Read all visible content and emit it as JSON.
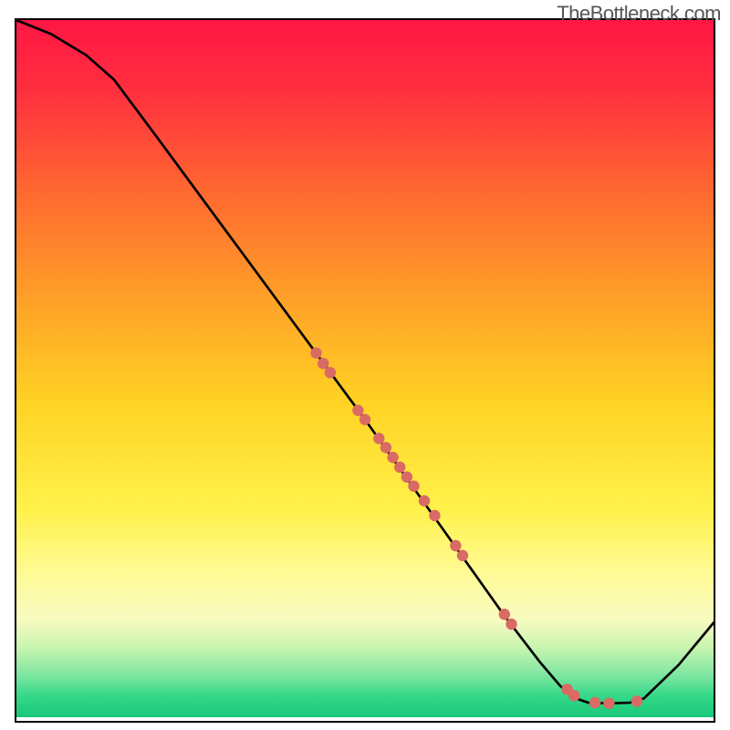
{
  "watermark": "TheBottleneck.com",
  "chart_data": {
    "type": "line",
    "title": "",
    "xlabel": "",
    "ylabel": "",
    "xlim": [
      0,
      100
    ],
    "ylim": [
      0,
      100
    ],
    "grid": false,
    "curve": [
      {
        "x": 0,
        "y": 100
      },
      {
        "x": 5,
        "y": 98
      },
      {
        "x": 10,
        "y": 95
      },
      {
        "x": 14,
        "y": 91.5
      },
      {
        "x": 20,
        "y": 83.5
      },
      {
        "x": 30,
        "y": 70
      },
      {
        "x": 40,
        "y": 56.5
      },
      {
        "x": 50,
        "y": 43
      },
      {
        "x": 55,
        "y": 36
      },
      {
        "x": 60,
        "y": 29
      },
      {
        "x": 65,
        "y": 22
      },
      {
        "x": 70,
        "y": 15
      },
      {
        "x": 75,
        "y": 8.5
      },
      {
        "x": 78,
        "y": 5
      },
      {
        "x": 80,
        "y": 3.3
      },
      {
        "x": 82,
        "y": 2.6
      },
      {
        "x": 85,
        "y": 2.5
      },
      {
        "x": 88,
        "y": 2.6
      },
      {
        "x": 90,
        "y": 3.2
      },
      {
        "x": 95,
        "y": 8
      },
      {
        "x": 100,
        "y": 14
      }
    ],
    "points": [
      {
        "x": 43,
        "y": 52.5
      },
      {
        "x": 44,
        "y": 51
      },
      {
        "x": 45,
        "y": 49.7
      },
      {
        "x": 49,
        "y": 44.3
      },
      {
        "x": 50,
        "y": 43
      },
      {
        "x": 52,
        "y": 40.3
      },
      {
        "x": 53,
        "y": 39
      },
      {
        "x": 54,
        "y": 37.6
      },
      {
        "x": 55,
        "y": 36.2
      },
      {
        "x": 56,
        "y": 34.8
      },
      {
        "x": 57,
        "y": 33.5
      },
      {
        "x": 58.5,
        "y": 31.4
      },
      {
        "x": 60,
        "y": 29.3
      },
      {
        "x": 63,
        "y": 25
      },
      {
        "x": 64,
        "y": 23.6
      },
      {
        "x": 70,
        "y": 15.2
      },
      {
        "x": 71,
        "y": 13.8
      },
      {
        "x": 79,
        "y": 4.5
      },
      {
        "x": 80,
        "y": 3.6
      },
      {
        "x": 83,
        "y": 2.6
      },
      {
        "x": 85,
        "y": 2.5
      },
      {
        "x": 89,
        "y": 2.8
      }
    ],
    "gradient_stops": [
      {
        "offset": 0,
        "color": "#ff1744"
      },
      {
        "offset": 0.1,
        "color": "#ff2f3f"
      },
      {
        "offset": 0.25,
        "color": "#ff6a30"
      },
      {
        "offset": 0.4,
        "color": "#ffa028"
      },
      {
        "offset": 0.55,
        "color": "#ffd324"
      },
      {
        "offset": 0.7,
        "color": "#fff14a"
      },
      {
        "offset": 0.8,
        "color": "#fffb9a"
      },
      {
        "offset": 0.86,
        "color": "#f8fbc0"
      },
      {
        "offset": 0.9,
        "color": "#c8f5b0"
      },
      {
        "offset": 0.94,
        "color": "#7de6a0"
      },
      {
        "offset": 0.97,
        "color": "#34d889"
      },
      {
        "offset": 1.0,
        "color": "#18c878"
      }
    ],
    "point_color": "#d96a64",
    "curve_color": "#000000",
    "point_radius": 6.2
  }
}
